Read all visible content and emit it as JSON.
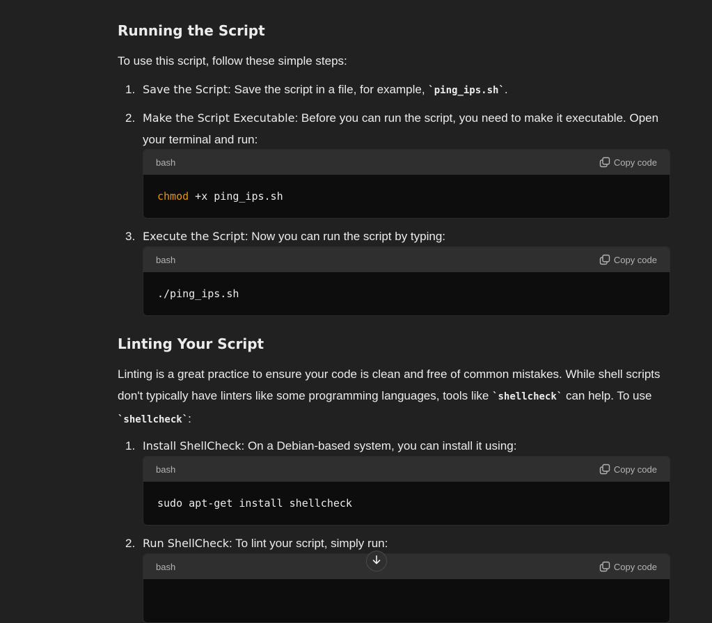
{
  "sections": {
    "running": {
      "title": "Running the Script",
      "intro": "To use this script, follow these simple steps:",
      "steps": [
        {
          "num": "1.",
          "bold": "Save the Script",
          "text_before": ": Save the script in a file, for example, ",
          "code": "`ping_ips.sh`",
          "text_after": "."
        },
        {
          "num": "2.",
          "bold": "Make the Script Executable",
          "text": ": Before you can run the script, you need to make it executable. Open your terminal and run:"
        },
        {
          "num": "3.",
          "bold": "Execute the Script",
          "text": ": Now you can run the script by typing:"
        }
      ]
    },
    "linting": {
      "title": "Linting Your Script",
      "intro_before": "Linting is a great practice to ensure your code is clean and free of common mistakes. While shell scripts don't typically have linters like some programming languages, tools like ",
      "intro_code1": "`shellcheck`",
      "intro_middle": " can help. To use ",
      "intro_code2": "`shellcheck`",
      "intro_after": ":",
      "steps": [
        {
          "num": "1.",
          "bold": "Install ShellCheck",
          "text": ": On a Debian-based system, you can install it using:"
        },
        {
          "num": "2.",
          "bold": "Run ShellCheck",
          "text": ": To lint your script, simply run:"
        }
      ]
    }
  },
  "code_blocks": [
    {
      "lang": "bash",
      "copy_label": "Copy code",
      "keyword": "chmod",
      "rest": " +x ping_ips.sh"
    },
    {
      "lang": "bash",
      "copy_label": "Copy code",
      "code": "./ping_ips.sh"
    },
    {
      "lang": "bash",
      "copy_label": "Copy code",
      "code": "sudo apt-get install shellcheck"
    },
    {
      "lang": "bash",
      "copy_label": "Copy code"
    }
  ],
  "icons": {
    "copy": "copy-icon",
    "scroll_down": "arrow-down-icon"
  },
  "colors": {
    "background": "#212121",
    "code_header": "#2f2f2f",
    "code_body": "#0d0d0d",
    "keyword": "#e9950c"
  }
}
